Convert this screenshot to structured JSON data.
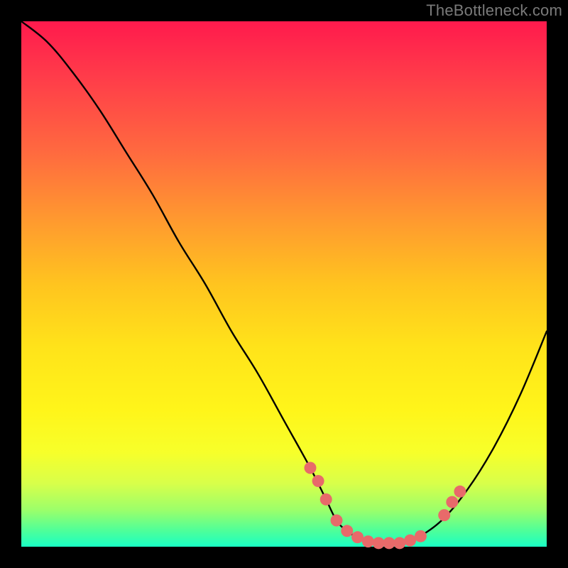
{
  "watermark": {
    "text": "TheBottleneck.com"
  },
  "chart_data": {
    "type": "line",
    "title": "",
    "xlabel": "",
    "ylabel": "",
    "xlim": [
      0,
      100
    ],
    "ylim": [
      0,
      100
    ],
    "series": [
      {
        "name": "bottleneck-curve",
        "x": [
          0,
          5,
          10,
          15,
          20,
          25,
          30,
          35,
          40,
          45,
          50,
          55,
          58,
          60,
          62,
          65,
          68,
          72,
          75,
          80,
          85,
          90,
          95,
          100
        ],
        "values": [
          100,
          96,
          90,
          83,
          75,
          67,
          58,
          50,
          41,
          33,
          24,
          15,
          9,
          5,
          3,
          1.2,
          0.7,
          0.7,
          1.5,
          5,
          11,
          19,
          29,
          41
        ]
      }
    ],
    "markers": {
      "name": "highlight-points",
      "color": "#e86a6a",
      "x": [
        55,
        56.5,
        58,
        60,
        62,
        64,
        66,
        68,
        70,
        72,
        74,
        76,
        80.5,
        82,
        83.5
      ],
      "values": [
        15,
        12.5,
        9,
        5,
        3,
        1.8,
        1.0,
        0.7,
        0.7,
        0.7,
        1.2,
        2.0,
        6.0,
        8.5,
        10.5
      ]
    }
  }
}
